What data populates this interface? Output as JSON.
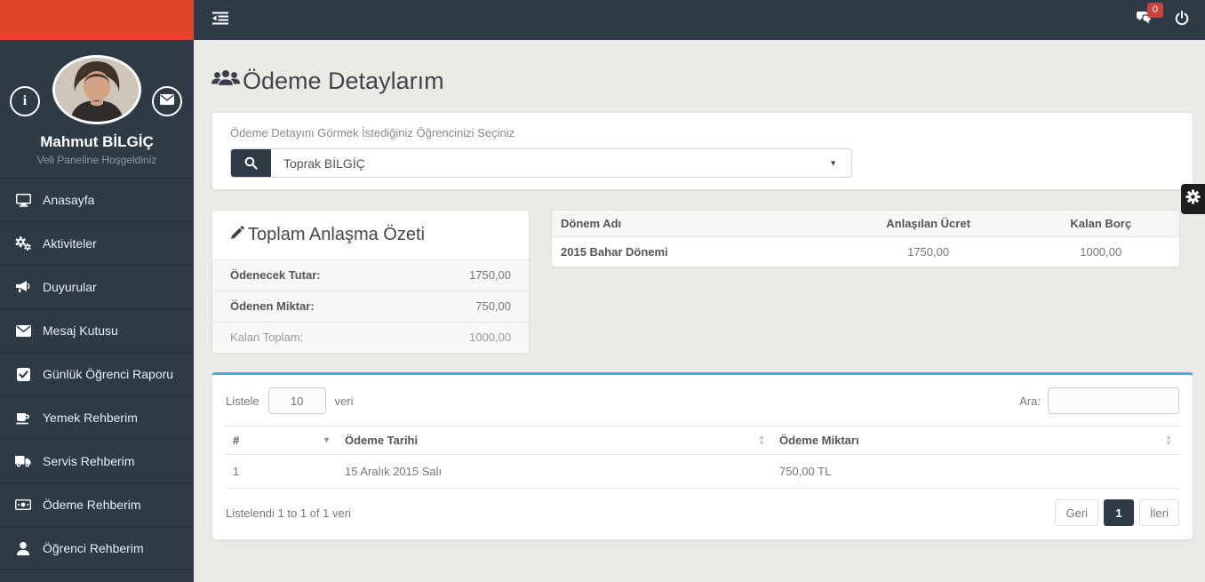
{
  "topbar": {
    "badge": "0"
  },
  "profile": {
    "name": "Mahmut BİLGİÇ",
    "subtitle": "Veli Paneline Hoşgeldiniz"
  },
  "sidebar": {
    "items": [
      {
        "label": "Anasayfa",
        "icon": "monitor"
      },
      {
        "label": "Aktiviteler",
        "icon": "gears"
      },
      {
        "label": "Duyurular",
        "icon": "megaphone"
      },
      {
        "label": "Mesaj Kutusu",
        "icon": "envelope"
      },
      {
        "label": "Günlük Öğrenci Raporu",
        "icon": "check-square"
      },
      {
        "label": "Yemek Rehberim",
        "icon": "coffee-cup"
      },
      {
        "label": "Servis Rehberim",
        "icon": "truck"
      },
      {
        "label": "Ödeme Rehberim",
        "icon": "banknote"
      },
      {
        "label": "Öğrenci Rehberim",
        "icon": "user"
      }
    ]
  },
  "page": {
    "title": "Ödeme Detaylarım"
  },
  "student_select": {
    "label": "Ödeme Detayını Görmek İstediğiniz Öğrencinizi Seçiniz",
    "value": "Toprak BİLGİÇ"
  },
  "summary": {
    "title": "Toplam Anlaşma Özeti",
    "rows": [
      {
        "label": "Ödenecek Tutar:",
        "value": "1750,00"
      },
      {
        "label": "Ödenen Miktar:",
        "value": "750,00"
      },
      {
        "label": "Kalan Toplam:",
        "value": "1000,00"
      }
    ]
  },
  "period_table": {
    "headers": [
      "Dönem Adı",
      "Anlaşılan Ücret",
      "Kalan Borç"
    ],
    "rows": [
      [
        "2015 Bahar Dönemi",
        "1750,00",
        "1000,00"
      ]
    ]
  },
  "payments": {
    "length_label_before": "Listele",
    "length_value": "10",
    "length_label_after": "veri",
    "search_label": "Ara:",
    "headers": [
      "#",
      "Ödeme Tarihi",
      "Ödeme Miktarı"
    ],
    "rows": [
      [
        "1",
        "15 Aralık 2015 Salı",
        "750,00 TL"
      ]
    ],
    "info": "Listelendi 1 to 1 of 1 veri",
    "pagination": {
      "prev": "Geri",
      "page": "1",
      "next": "İleri"
    }
  },
  "icons": {
    "caret_down": "▼",
    "caret_up": "▲",
    "info": "i"
  },
  "colors": {
    "brand_orange": "#e24628",
    "dark_slate": "#2e3a46",
    "accent_blue": "#38b2d8",
    "badge_red": "#c64540",
    "settings_black": "#1e1e1e",
    "content_bg": "#eceae5"
  }
}
